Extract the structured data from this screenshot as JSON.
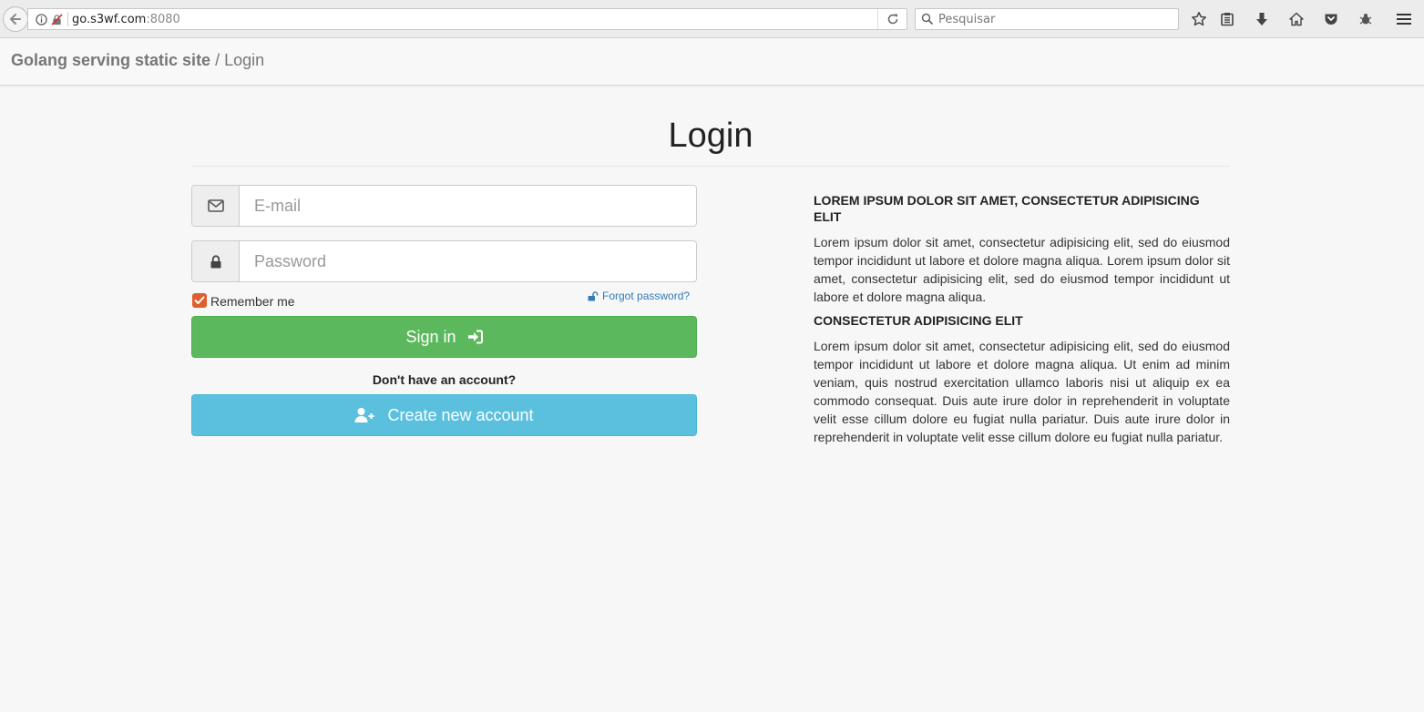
{
  "browser": {
    "url_host": "go.s3wf.com",
    "url_port": ":8080",
    "search_placeholder": "Pesquisar"
  },
  "header": {
    "brand": "Golang serving static site",
    "separator": " / ",
    "current": "Login"
  },
  "main": {
    "title": "Login",
    "email_placeholder": "E-mail",
    "password_placeholder": "Password",
    "remember_label": "Remember me",
    "remember_checked": true,
    "forgot_label": "Forgot password?",
    "signin_label": "Sign in",
    "no_account_text": "Don't have an account?",
    "create_label": "Create new account"
  },
  "info": {
    "heading1": "LOREM IPSUM DOLOR SIT AMET, CONSECTETUR ADIPISICING ELIT",
    "para1": "Lorem ipsum dolor sit amet, consectetur adipisicing elit, sed do eiusmod tempor incididunt ut labore et dolore magna aliqua. Lorem ipsum dolor sit amet, consectetur adipisicing elit, sed do eiusmod tempor incididunt ut labore et dolore magna aliqua.",
    "heading2": "CONSECTETUR ADIPISICING ELIT",
    "para2": "Lorem ipsum dolor sit amet, consectetur adipisicing elit, sed do eiusmod tempor incididunt ut labore et dolore magna aliqua. Ut enim ad minim veniam, quis nostrud exercitation ullamco laboris nisi ut aliquip ex ea commodo consequat. Duis aute irure dolor in reprehenderit in voluptate velit esse cillum dolore eu fugiat nulla pariatur. Duis aute irure dolor in reprehenderit in voluptate velit esse cillum dolore eu fugiat nulla pariatur."
  },
  "colors": {
    "signin": "#5cb85c",
    "create": "#5bc0de",
    "checkbox": "#e05d2e",
    "link": "#337ab7"
  },
  "icons": {
    "email": "envelope-icon",
    "password": "lock-icon",
    "signin": "sign-in-icon",
    "create": "user-plus-icon",
    "forgot": "unlock-icon"
  }
}
